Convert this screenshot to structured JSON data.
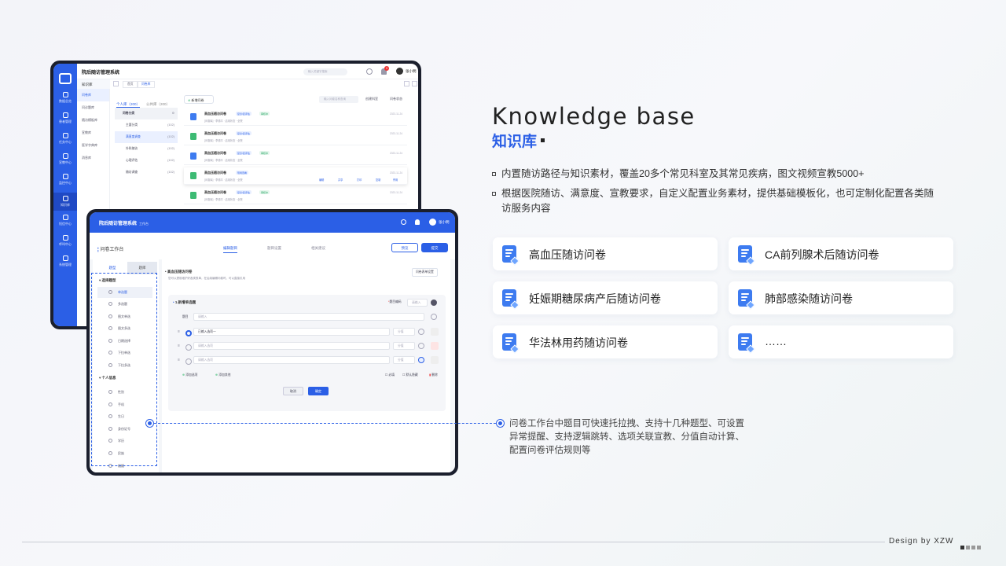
{
  "title_en": "Knowledge base",
  "title_zh": "知识库",
  "bullets": [
    "内置随访路径与知识素材，覆盖20多个常见科室及其常见疾病，图文视频宣教5000+",
    "根据医院随访、满意度、宣教要求，自定义配置业务素材，提供基础模板化，也可定制化配置各类随访服务内容"
  ],
  "cards": [
    "高血压随访问卷",
    "CA前列腺术后随访问卷",
    "妊娠期糖尿病产后随访问卷",
    "肺部感染随访问卷",
    "华法林用药随访问卷",
    "……"
  ],
  "callout": "问卷工作台中题目可快速托拉拽、支持十几种题型、可设置异常提醒、支持逻辑跳转、选项关联宣教、分值自动计算、配置问卷评估规则等",
  "footer": "Design by XZW",
  "colors": {
    "accent": "#2b5fe6",
    "green": "#3dbb74"
  },
  "app1": {
    "title": "院后随访管理系统",
    "search_placeholder": "输入关键字搜索",
    "user": "张小明",
    "badge": "3",
    "section": "知识库",
    "tabs": [
      "首页",
      "问卷库"
    ],
    "nav": [
      "数据总览",
      "患者管理",
      "任务中心",
      "宣教中心",
      "监控中心",
      "知识库",
      "短信中心",
      "呼叫中心",
      "系统管理"
    ],
    "menu": [
      "问卷库",
      "问诊题库",
      "随访模板库",
      "宣教库",
      "医学字典库",
      "消息库"
    ],
    "tree_tabs": [
      "个人库（200）",
      "公共库（200）"
    ],
    "tree": [
      {
        "label": "问卷分类",
        "n": ""
      },
      {
        "label": "主要分类",
        "n": "(102)"
      },
      {
        "label": "满意度调查",
        "n": "(102)"
      },
      {
        "label": "外科随访",
        "n": "(102)"
      },
      {
        "label": "心理评估",
        "n": "(102)"
      },
      {
        "label": "随访调查",
        "n": "(102)"
      }
    ],
    "add_btn": "新增问卷",
    "filter_placeholder": "输入问卷名称查询",
    "filter1": "创建科室",
    "filter2": "问卷状态",
    "item_name": "高血压随访问卷",
    "item_sub": "[问卷库]  · 李德平 · 启用状态 · 全院",
    "item_date": "2023-11-24",
    "tag1": "复诊/复评估",
    "tag2": "审核中",
    "tag3": "现场查看",
    "actions": [
      "编辑",
      "共享",
      "打印",
      "复制",
      "停用"
    ]
  },
  "app2": {
    "title": "院后随访管理系统",
    "subtitle": "工作台",
    "user": "张小明",
    "workbench": "问卷工作台",
    "tabs": [
      "编辑题目",
      "题目设置",
      "相关建议"
    ],
    "preview": "预览",
    "submit": "提交",
    "left_tabs": [
      "题型",
      "题库"
    ],
    "sec1": "选择题型",
    "types": [
      "单选题",
      "多选题",
      "图文单选",
      "图文多选",
      "日期选择",
      "下拉单选",
      "下拉多选"
    ],
    "sec2": "个人信息",
    "personal": [
      "性别",
      "手机",
      "生日",
      "身份证号",
      "学历",
      "民族",
      "婚姻"
    ],
    "survey_name": "高血压随访问卷",
    "survey_desc": "您可以提前维护好各类表单，在后续编辑问卷时，可以直接引用",
    "settings_btn": "问卷表单设置",
    "q_title": "1.新增单选题",
    "q_code_label": "题目编码",
    "q_code_ph": "请输入",
    "q_stem_label": "题目",
    "q_stem_ph": "请输入",
    "opt1": "已输入选项一",
    "opt_ph": "请输入选项",
    "score": "分值",
    "add_opt": "添加选项",
    "add_other": "添加其他",
    "required": "必填",
    "hidden": "默认隐藏",
    "delete": "删除",
    "cancel": "取消",
    "ok": "确定"
  }
}
